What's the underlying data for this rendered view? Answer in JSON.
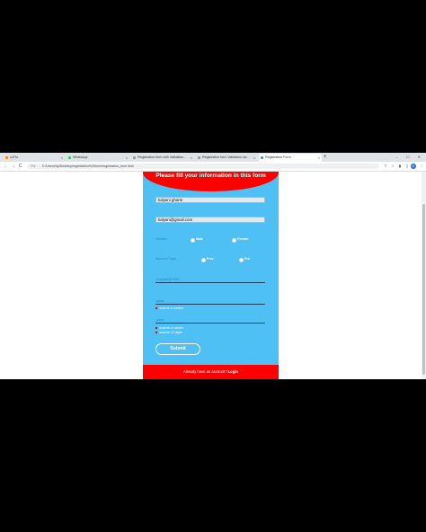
{
  "browser": {
    "tabs": [
      {
        "label": "cuTto",
        "color": "#ff8800"
      },
      {
        "label": "WhatsApp",
        "color": "#25d366"
      },
      {
        "label": "Registration form with Validation...",
        "color": "#999999"
      },
      {
        "label": "Registration form Validation usi...",
        "color": "#999999"
      },
      {
        "label": "Registration Form",
        "color": "#4a90e2"
      }
    ],
    "new_tab": "+",
    "window_controls": "– ☐ ✕",
    "back": "←",
    "forward": "→",
    "reload": "C",
    "url_label": "File",
    "url": "C:/Users/hp/Desktop/registration%20form/registration_form.html",
    "profile_initial": "K"
  },
  "form": {
    "title": "Please fill your information in this form",
    "name_value": "kalyani gharte",
    "email_value": "kalyani@gmail.com",
    "gender_label": "Gender",
    "gender_options": [
      "Male",
      "Female"
    ],
    "account_label": "Account Type",
    "account_options": [
      "Free",
      "Pro"
    ],
    "username_value": "Kalyani@7557",
    "password1_placeholder": "pass",
    "password1_errors": [
      "must be a number"
    ],
    "password2_placeholder": "pass",
    "password2_errors": [
      "must be a number",
      "must be 12 digits"
    ],
    "submit_label": "Submit",
    "footer_prefix": "Already have an account?",
    "footer_link": "Login"
  },
  "colors": {
    "form_background": "#4ec0f3",
    "header_red": "#ff0000"
  }
}
